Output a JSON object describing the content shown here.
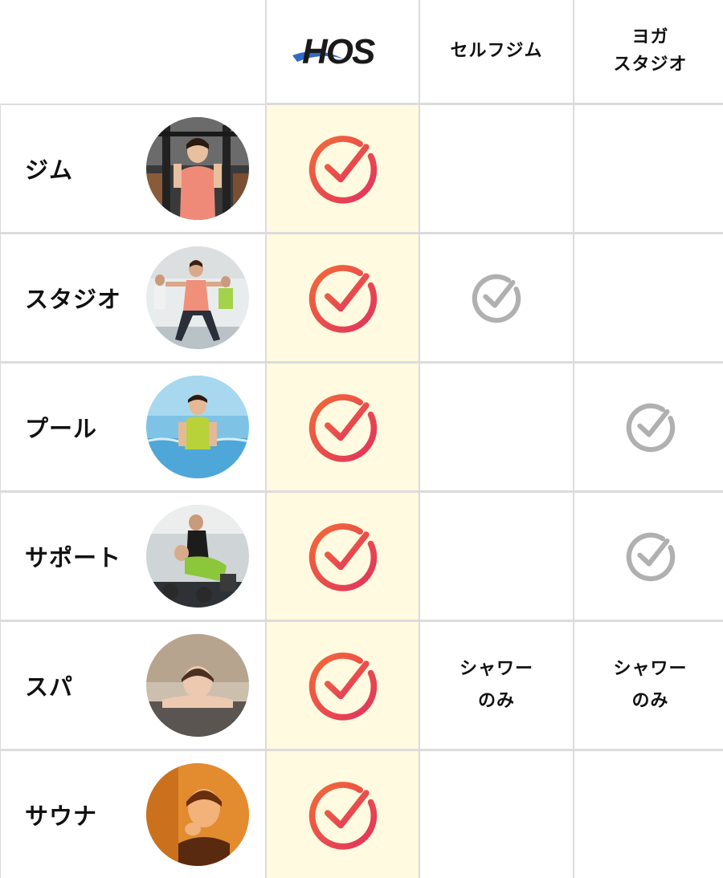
{
  "header": {
    "brand_logo_text": "HOS",
    "col_self_gym": "セルフジム",
    "col_yoga_line1": "ヨガ",
    "col_yoga_line2": "スタジオ"
  },
  "rows": [
    {
      "label": "ジム",
      "photo": "gym-woman-photo",
      "hos": true,
      "self_gym": "",
      "yoga": ""
    },
    {
      "label": "スタジオ",
      "photo": "studio-class-photo",
      "hos": true,
      "self_gym": "check",
      "yoga": ""
    },
    {
      "label": "プール",
      "photo": "pool-woman-photo",
      "hos": true,
      "self_gym": "",
      "yoga": "check"
    },
    {
      "label": "サポート",
      "photo": "trainer-support-photo",
      "hos": true,
      "self_gym": "",
      "yoga": "check"
    },
    {
      "label": "スパ",
      "photo": "spa-woman-photo",
      "hos": true,
      "self_gym_note_line1": "シャワー",
      "self_gym_note_line2": "のみ",
      "yoga_note_line1": "シャワー",
      "yoga_note_line2": "のみ"
    },
    {
      "label": "サウナ",
      "photo": "sauna-woman-photo",
      "hos": true,
      "self_gym": "",
      "yoga": ""
    }
  ],
  "colors": {
    "check_primary_start": "#f0613c",
    "check_primary_end": "#e23a5c",
    "check_secondary": "#b0b0b0",
    "hos_column_bg": "#fffae0",
    "grid_line": "#dcdcdc",
    "logo_blue": "#2f6bc4",
    "logo_text": "#1a1a1a"
  }
}
